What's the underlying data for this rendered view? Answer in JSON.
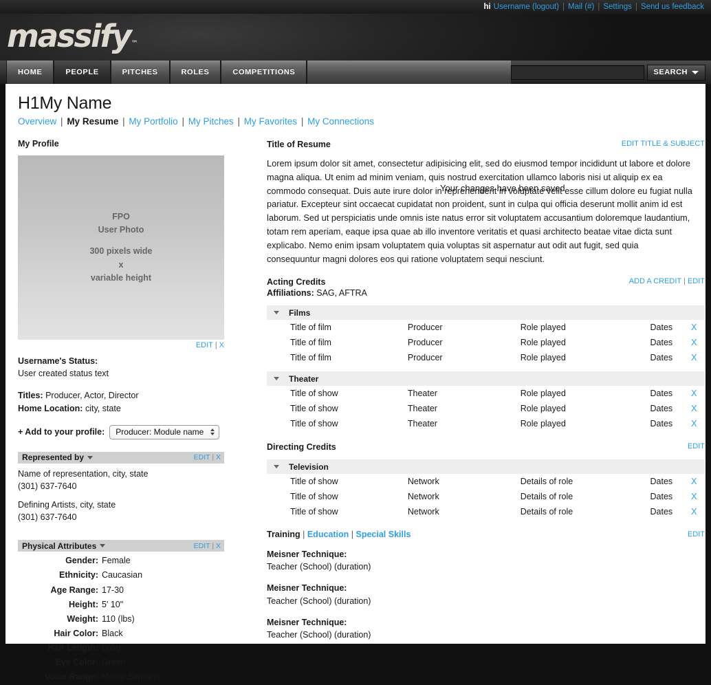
{
  "topbar": {
    "greeting": "hi",
    "username": "Username",
    "logout": "logout",
    "mail": "Mail (#)",
    "settings": "Settings",
    "feedback": "Send us feedback",
    "link_color": "#2f9fe0"
  },
  "brand": {
    "name": "massify",
    "tm": "™"
  },
  "nav": {
    "tabs": [
      {
        "label": "HOME",
        "active": false
      },
      {
        "label": "PEOPLE",
        "active": true
      },
      {
        "label": "PITCHES",
        "active": false
      },
      {
        "label": "ROLES",
        "active": false
      },
      {
        "label": "COMPETITIONS",
        "active": false
      }
    ],
    "search": {
      "value": "",
      "placeholder": "",
      "button_label": "SEARCH"
    }
  },
  "page": {
    "title": "H1My Name",
    "saved_message": "Your changes have been saved",
    "subnav": [
      {
        "label": "Overview",
        "current": false
      },
      {
        "label": "My Resume",
        "current": true
      },
      {
        "label": "My Portfolio",
        "current": false
      },
      {
        "label": "My Pitches",
        "current": false
      },
      {
        "label": "My Favorites",
        "current": false
      },
      {
        "label": "My Connections",
        "current": false
      }
    ]
  },
  "sidebar": {
    "heading": "My Profile",
    "photo": {
      "line1": "FPO",
      "line2": "User Photo",
      "line3": "300 pixels wide",
      "line4": "x",
      "line5": "variable height"
    },
    "photo_actions": {
      "edit": "EDIT",
      "close": "X"
    },
    "status": {
      "label": "Username's Status:",
      "text": "User created status text"
    },
    "titles": {
      "label": "Titles:",
      "value": "Producer, Actor, Director"
    },
    "home_location": {
      "label": "Home Location:",
      "value": "city, state"
    },
    "add_profile": {
      "label": "+ Add to your profile:",
      "selected": "Producer: Module name"
    },
    "represented_by": {
      "title": "Represented by",
      "edit": "EDIT",
      "close": "X",
      "entries": [
        {
          "name": "Name of representation, city, state",
          "phone": "(301) 637-7640"
        },
        {
          "name": "Defining Artists, city, state",
          "phone": "(301) 637-7640"
        }
      ]
    },
    "physical_attributes": {
      "title": "Physical Attributes",
      "edit": "EDIT",
      "close": "X",
      "rows": [
        {
          "key": "Gender:",
          "value": "Female"
        },
        {
          "key": "Ethnicity:",
          "value": "Caucasian"
        },
        {
          "key": "Age Range:",
          "value": "17-30"
        },
        {
          "key": "Height:",
          "value": "5' 10\""
        },
        {
          "key": "Weight:",
          "value": "110 (lbs)"
        },
        {
          "key": "Hair Color:",
          "value": "Black"
        },
        {
          "key": "Hair Length:",
          "value": "Long"
        },
        {
          "key": "Eye Color:",
          "value": "Green"
        },
        {
          "key": "Voice Range:",
          "value": "Metso Saprano"
        }
      ]
    }
  },
  "main": {
    "resume": {
      "title": "Title of Resume",
      "edit_link": "EDIT TITLE & SUBJECT",
      "body": "Lorem ipsum dolor sit amet, consectetur adipisicing elit, sed do eiusmod tempor incididunt ut labore et dolore magna aliqua. Ut enim ad minim veniam, quis nostrud exercitation ullamco laboris nisi ut aliquip ex ea commodo consequat. Duis aute irure dolor in reprehenderit in voluptate velit esse cillum dolore eu fugiat nulla pariatur. Excepteur sint occaecat cupidatat non proident, sunt in culpa qui officia deserunt mollit anim id est laborum. Sed ut perspiciatis unde omnis iste natus error sit voluptatem accusantium doloremque laudantium, totam rem aperiam, eaque ipsa quae ab illo inventore veritatis et quasi architecto beatae vitae dicta sunt explicabo. Nemo enim ipsam voluptatem quia voluptas sit aspernatur aut odit aut fugit, sed quia consequuntur magni dolores eos qui ratione voluptatem sequi nesciunt."
    },
    "acting_credits": {
      "title": "Acting Credits",
      "affiliations_label": "Affiliations:",
      "affiliations_value": "SAG, AFTRA",
      "add_link": "ADD A CREDIT",
      "edit_link": "EDIT",
      "groups": [
        {
          "name": "Films",
          "rows": [
            {
              "c1": "Title of film",
              "c2": "Producer",
              "c3": "Role played",
              "c4": "Dates",
              "c5": "X"
            },
            {
              "c1": "Title of film",
              "c2": "Producer",
              "c3": "Role played",
              "c4": "Dates",
              "c5": "X"
            },
            {
              "c1": "Title of film",
              "c2": "Producer",
              "c3": "Role played",
              "c4": "Dates",
              "c5": "X"
            }
          ]
        },
        {
          "name": "Theater",
          "rows": [
            {
              "c1": "Title of show",
              "c2": "Theater",
              "c3": "Role played",
              "c4": "Dates",
              "c5": "X"
            },
            {
              "c1": "Title of show",
              "c2": "Theater",
              "c3": "Role played",
              "c4": "Dates",
              "c5": "X"
            },
            {
              "c1": "Title of show",
              "c2": "Theater",
              "c3": "Role played",
              "c4": "Dates",
              "c5": "X"
            }
          ]
        }
      ]
    },
    "directing_credits": {
      "title": "Directing Credits",
      "edit_link": "EDIT",
      "groups": [
        {
          "name": "Television",
          "rows": [
            {
              "c1": "Title of show",
              "c2": "Network",
              "c3": "Details of role",
              "c4": "Dates",
              "c5": "X"
            },
            {
              "c1": "Title of show",
              "c2": "Network",
              "c3": "Details of role",
              "c4": "Dates",
              "c5": "X"
            },
            {
              "c1": "Title of show",
              "c2": "Network",
              "c3": "Details of role",
              "c4": "Dates",
              "c5": "X"
            }
          ]
        }
      ]
    },
    "training": {
      "tabs": [
        {
          "label": "Training",
          "current": true
        },
        {
          "label": "Education",
          "current": false
        },
        {
          "label": "Special Skills",
          "current": false
        }
      ],
      "edit_link": "EDIT",
      "entries": [
        {
          "title": "Meisner Technique:",
          "detail": "Teacher (School) (duration)"
        },
        {
          "title": "Meisner Technique:",
          "detail": "Teacher (School) (duration)"
        },
        {
          "title": "Meisner Technique:",
          "detail": "Teacher (School) (duration)"
        }
      ]
    }
  }
}
